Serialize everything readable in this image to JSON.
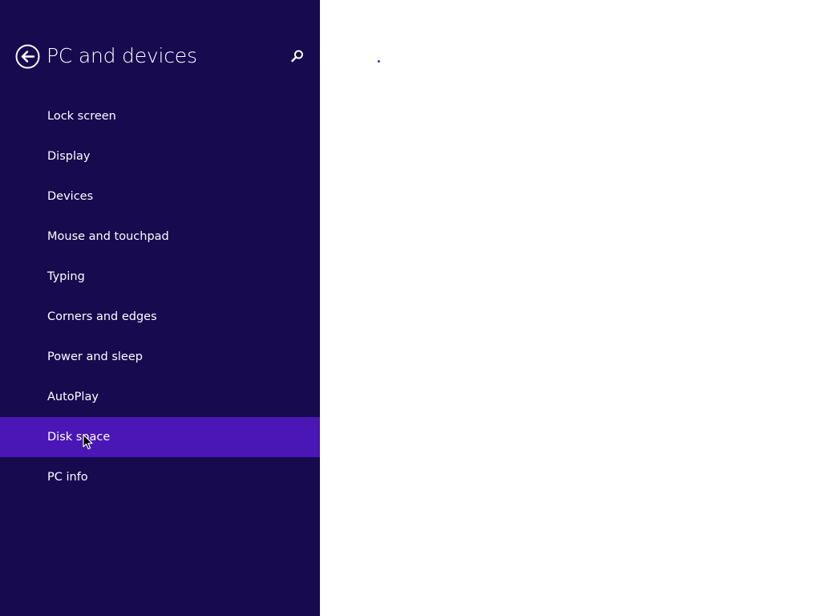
{
  "window": {
    "title": "PC and devices"
  },
  "header": {
    "back_icon": "back-arrow-circle-icon",
    "search_icon": "search-icon"
  },
  "nav": {
    "items": [
      {
        "label": "Lock screen"
      },
      {
        "label": "Display"
      },
      {
        "label": "Devices"
      },
      {
        "label": "Mouse and touchpad"
      },
      {
        "label": "Typing"
      },
      {
        "label": "Corners and edges"
      },
      {
        "label": "Power and sleep"
      },
      {
        "label": "AutoPlay"
      },
      {
        "label": "Disk space",
        "selected": true
      },
      {
        "label": "PC info"
      }
    ]
  },
  "content": {
    "loading_indicator": "progress-dot"
  },
  "colors": {
    "sidebar_bg": "#180a4f",
    "selected_bg": "#4a16b5",
    "content_bg": "#ffffff",
    "text": "#ffffff",
    "accent_dot": "#3b2bd1"
  }
}
